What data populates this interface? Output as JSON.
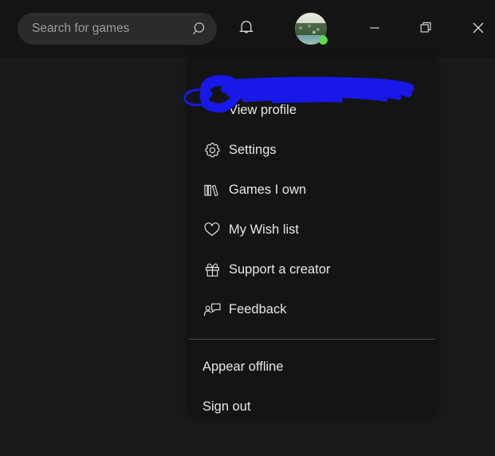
{
  "window": {
    "background_color": "#1a1a1a",
    "titlebar_color": "#141414"
  },
  "titlebar": {
    "search": {
      "placeholder": "Search for games",
      "value": "",
      "icon": "search-icon"
    },
    "notifications": {
      "icon": "bell-icon",
      "label": "Notifications"
    },
    "account": {
      "icon": "avatar",
      "status": "online",
      "status_color": "#5ddb4d"
    },
    "window_controls": [
      {
        "name": "minimize",
        "icon": "minimize-icon",
        "glyph": "─"
      },
      {
        "name": "maximize",
        "icon": "restore-icon",
        "glyph": "❐"
      },
      {
        "name": "close",
        "icon": "close-icon",
        "glyph": "✕"
      }
    ]
  },
  "account_menu": {
    "username_redacted": true,
    "redaction_color": "#1818e8",
    "panel_color": "#141414",
    "items": [
      {
        "label": "View profile",
        "icon": null
      },
      {
        "label": "Settings",
        "icon": "gear-icon"
      },
      {
        "label": "Games I own",
        "icon": "books-icon"
      },
      {
        "label": "My Wish list",
        "icon": "heart-icon"
      },
      {
        "label": "Support a creator",
        "icon": "gift-icon"
      },
      {
        "label": "Feedback",
        "icon": "feedback-icon"
      }
    ],
    "footer_items": [
      {
        "label": "Appear offline",
        "icon": null
      },
      {
        "label": "Sign out",
        "icon": null
      }
    ]
  }
}
